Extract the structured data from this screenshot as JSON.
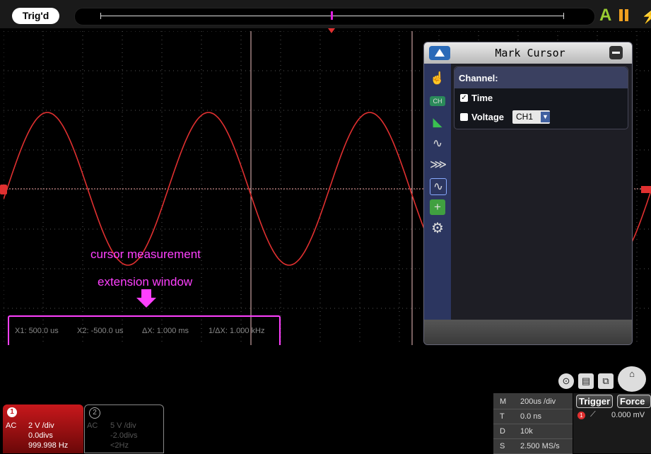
{
  "top_bar": {
    "trigger_status": "Trig'd",
    "auto_icon": "A",
    "icons": [
      "auto-icon",
      "pause-icon",
      "power-icon"
    ]
  },
  "mark_cursor_panel": {
    "title": "Mark Cursor",
    "channel_label": "Channel:",
    "time_option": "Time",
    "time_checked": true,
    "voltage_option": "Voltage",
    "voltage_checked": false,
    "voltage_channel": "CH1",
    "side_icons": [
      "hand-pointer-icon",
      "ch-icon",
      "ruler-icon",
      "waveform-icon",
      "fft-icon",
      "math-wave-icon",
      "crosshair-icon",
      "gear-icon"
    ]
  },
  "annotation": {
    "line1": "cursor measurement",
    "line2": "extension window"
  },
  "measurements": {
    "x1": "X1: 500.0 us",
    "x2": "X2: -500.0 us",
    "dx": "ΔX: 1.000 ms",
    "inv_dx": "1/ΔX: 1.000 kHz"
  },
  "ch1": {
    "number": "1",
    "coupling": "AC",
    "scale": "2 V /div",
    "offset": "0.0divs",
    "freq": "999.998 Hz"
  },
  "ch2": {
    "number": "2",
    "coupling": "AC",
    "scale": "5 V /div",
    "offset": "-2.0divs",
    "freq": "<2Hz"
  },
  "horizontal": {
    "rows": [
      {
        "key": "M",
        "value": "200us /div"
      },
      {
        "key": "T",
        "value": "0.0 ns"
      },
      {
        "key": "D",
        "value": "10k"
      },
      {
        "key": "S",
        "value": "2.500 MS/s"
      }
    ]
  },
  "trigger": {
    "trigger_label": "Trigger",
    "force_label": "Force",
    "level": "0.000 mV"
  },
  "colors": {
    "waveform": "#e03030",
    "accent": "#ff40ff",
    "grid": "#555555",
    "cursor": "#f0c0c0"
  }
}
